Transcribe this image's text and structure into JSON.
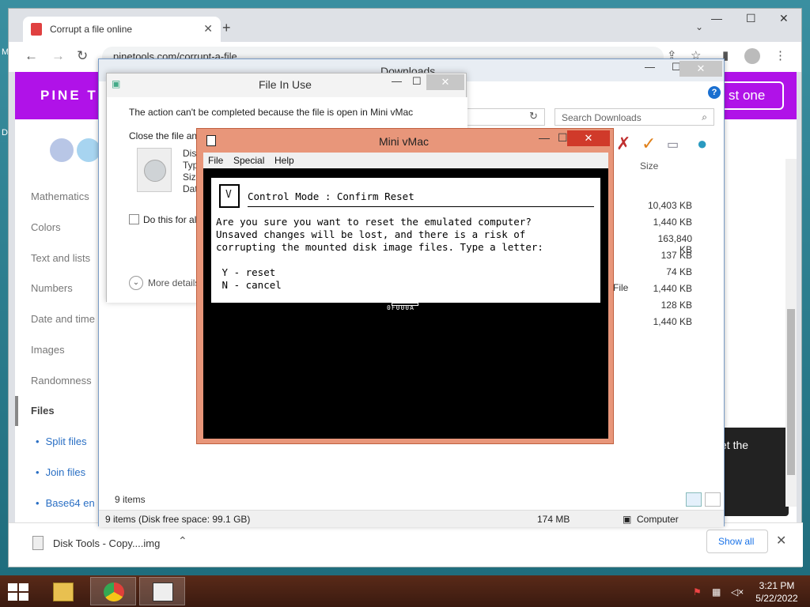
{
  "desktop": {
    "left_letters": [
      "M",
      "D"
    ]
  },
  "browser": {
    "tab_title": "Corrupt a file online",
    "url": "pinetools.com/corrupt-a-file",
    "window_controls": {
      "minimize": "—",
      "maximize": "☐",
      "close": "✕"
    }
  },
  "pinetools": {
    "logo": "PINE T",
    "button_fragment": "st one",
    "sidebar": [
      "Mathematics",
      "Colors",
      "Text and lists",
      "Numbers",
      "Date and time",
      "Images",
      "Randomness",
      "Files"
    ],
    "sidebar_sub": [
      "Split files",
      "Join files",
      "Base64 en"
    ],
    "card_fragment": "et the"
  },
  "download_bar": {
    "file_name": "Disk Tools - Copy....img",
    "show_all": "Show all"
  },
  "explorer": {
    "title": "Downloads",
    "search_placeholder": "Search Downloads",
    "size_header": "Size",
    "sizes": [
      "10,403 KB",
      "1,440 KB",
      "163,840 KB",
      "137 KB",
      "74 KB",
      "1,440 KB",
      "128 KB",
      "1,440 KB"
    ],
    "type_fragment": "File",
    "items_count": "9 items",
    "status_left": "9 items (Disk free space: 99.1 GB)",
    "status_size": "174 MB",
    "status_location": "Computer"
  },
  "file_in_use": {
    "title": "File In Use",
    "message": "The action can't be completed because the file is open in Mini vMac",
    "close_line": "Close the file and",
    "props": [
      "Dis",
      "Typ",
      "Size",
      "Dat"
    ],
    "checkbox_label": "Do this for al",
    "more_details": "More details"
  },
  "minivmac": {
    "title": "Mini vMac",
    "menu": [
      "File",
      "Special",
      "Help"
    ],
    "heading": "Control Mode : Confirm Reset",
    "lines": [
      "Are you sure you want to reset the emulated computer?",
      "Unsaved changes will be lost, and there is a risk of",
      "corrupting the mounted disk image files. Type a letter:"
    ],
    "option_y": " Y - reset",
    "option_n": " N - cancel",
    "code": "0F000A"
  },
  "taskbar": {
    "time": "3:21 PM",
    "date": "5/22/2022"
  }
}
